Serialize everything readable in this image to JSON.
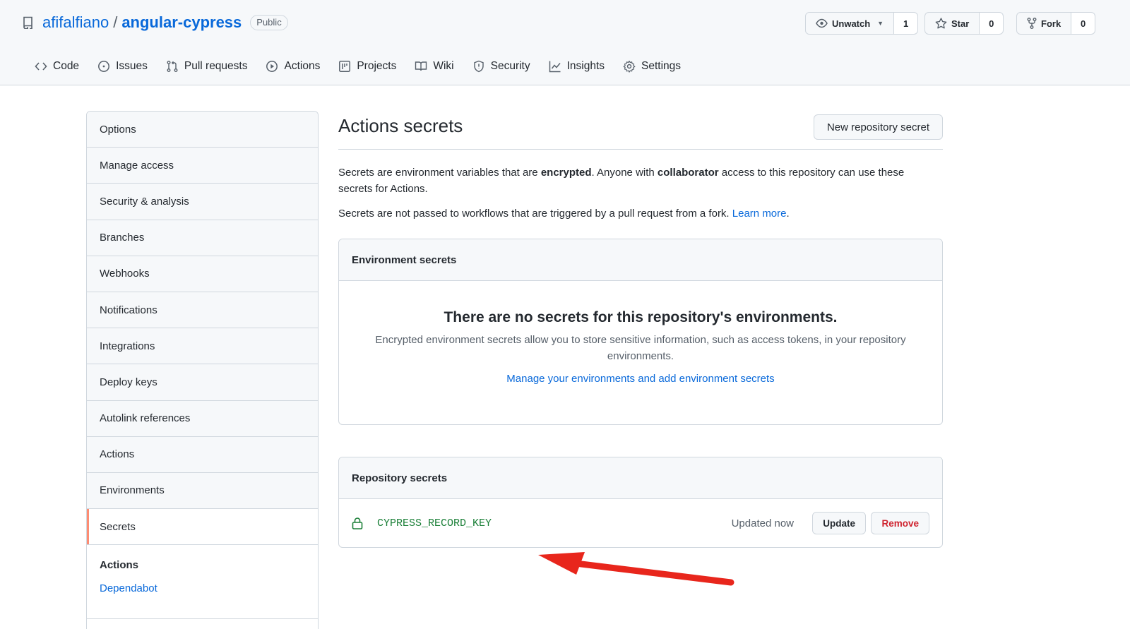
{
  "repo": {
    "owner": "afifalfiano",
    "separator": "/",
    "name": "angular-cypress",
    "visibility": "Public"
  },
  "actions": {
    "watch_label": "Unwatch",
    "watch_count": "1",
    "star_label": "Star",
    "star_count": "0",
    "fork_label": "Fork",
    "fork_count": "0"
  },
  "nav": [
    {
      "label": "Code",
      "icon": "code-icon"
    },
    {
      "label": "Issues",
      "icon": "issue-icon"
    },
    {
      "label": "Pull requests",
      "icon": "pull-request-icon"
    },
    {
      "label": "Actions",
      "icon": "play-icon"
    },
    {
      "label": "Projects",
      "icon": "project-icon"
    },
    {
      "label": "Wiki",
      "icon": "book-icon"
    },
    {
      "label": "Security",
      "icon": "shield-icon"
    },
    {
      "label": "Insights",
      "icon": "graph-icon"
    },
    {
      "label": "Settings",
      "icon": "gear-icon"
    }
  ],
  "sidebar": {
    "items": [
      "Options",
      "Manage access",
      "Security & analysis",
      "Branches",
      "Webhooks",
      "Notifications",
      "Integrations",
      "Deploy keys",
      "Autolink references",
      "Actions",
      "Environments",
      "Secrets"
    ],
    "selected": "Secrets",
    "group_title": "Actions",
    "group_link": "Dependabot"
  },
  "main": {
    "title": "Actions secrets",
    "new_button": "New repository secret",
    "desc_1": "Secrets are environment variables that are ",
    "desc_bold_1": "encrypted",
    "desc_2": ". Anyone with ",
    "desc_bold_2": "collaborator",
    "desc_3": " access to this repository can use these secrets for Actions.",
    "desc_fork": "Secrets are not passed to workflows that are triggered by a pull request from a fork. ",
    "learn_more": "Learn more",
    "period": "."
  },
  "environment_secrets": {
    "header": "Environment secrets",
    "empty_title": "There are no secrets for this repository's environments.",
    "empty_desc": "Encrypted environment secrets allow you to store sensitive information, such as access tokens, in your repository environments.",
    "link": "Manage your environments and add environment secrets"
  },
  "repository_secrets": {
    "header": "Repository secrets",
    "rows": [
      {
        "name": "CYPRESS_RECORD_KEY",
        "updated": "Updated now",
        "update": "Update",
        "remove": "Remove"
      }
    ]
  },
  "colors": {
    "link": "#0969da",
    "secret_green": "#1a7f37",
    "danger": "#cf222e",
    "selected_marker": "#fd8c73",
    "annotation_arrow": "#e8261c"
  }
}
